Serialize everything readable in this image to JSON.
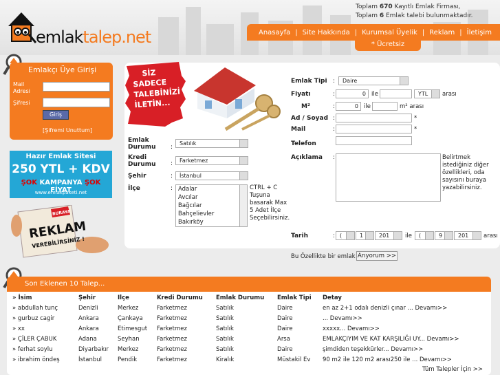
{
  "header": {
    "stats_line1_pre": "Toplam ",
    "stats_line1_num": "670",
    "stats_line1_post": " Kayıtlı Emlak Firması,",
    "stats_line2_pre": "Toplam ",
    "stats_line2_num": "6",
    "stats_line2_post": " Emlak talebi bulunmaktadır.",
    "logo_part1": "emlak",
    "logo_part2": "talep.net"
  },
  "nav": {
    "items": [
      "Anasayfa",
      "Site Hakkında",
      "Kurumsal Üyelik",
      "Reklam",
      "İletişim"
    ],
    "separator": "|",
    "sub": "* Ücretsiz"
  },
  "login": {
    "title": "Emlakçı Üye Girişi",
    "mail_label": "Mail Adresi",
    "password_label": "Şifresi",
    "submit": "Giriş",
    "forgot": "[Şifremi Unuttum]"
  },
  "banner1": {
    "line1": "Hazır Emlak Sitesi",
    "line2": "250 YTL + KDV",
    "line3_a": "ŞOK",
    "line3_b": " KAMPANYA ",
    "line3_c": "ŞOK",
    "line3_d": " FİYAT",
    "line4": "www.emlakpaketi.net"
  },
  "banner2": {
    "line1": "BURAYA",
    "line2": "REKLAM",
    "line3": "VEREBİLİRSİNİZ !"
  },
  "promo": {
    "line1": "SİZ",
    "line2": "SADECE",
    "line3": "TALEBİNİZİ",
    "line4": "İLETİN..."
  },
  "form": {
    "emlak_tipi_label": "Emlak Tipi",
    "emlak_tipi_value": "Daire",
    "fiyati_label": "Fiyatı",
    "fiyat_min": "0",
    "ile": "ile",
    "currency": "YTL",
    "arasi": "arası",
    "m2_label": "M²",
    "m2_min": "0",
    "m2_arasi": "m² arası",
    "adsoyad_label": "Ad / Soyad",
    "mail_label": "Mail",
    "star": "*",
    "telefon_label": "Telefon",
    "aciklama_label": "Açıklama",
    "aciklama_info": "Belirtmek istediğiniz diğer özellikleri, oda sayısını buraya yazabilirsiniz.",
    "emlak_durumu_label": "Emlak Durumu",
    "emlak_durumu_value": "Satılık",
    "kredi_durumu_label": "Kredi Durumu",
    "kredi_durumu_value": "Farketmez",
    "sehir_label": "Şehir",
    "sehir_value": "İstanbul",
    "ilce_label": "İlçe",
    "ilce_options": [
      "Adalar",
      "Avcılar",
      "Bağcılar",
      "Bahçelievler",
      "Bakırköy"
    ],
    "ilce_info": "CTRL + C Tuşuna basarak Max 5 Adet İlçe Seçebilirsiniz.",
    "colon": ":",
    "tarih_label": "Tarih",
    "tarih_d1": "(",
    "tarih_m1": "1",
    "tarih_y1": "201",
    "tarih_d2": "(",
    "tarih_m2": "9",
    "tarih_y2": "201",
    "bu_ozellik": "Bu Özellikte bir emlak",
    "anyorum": "Arıyorum >>"
  },
  "recent": {
    "title": "Son Eklenen 10 Talep...",
    "columns": [
      "İsim",
      "Şehir",
      "Ilçe",
      "Kredi Durumu",
      "Emlak Durumu",
      "Emlak Tipi",
      "Detay"
    ],
    "rows": [
      [
        "abdullah tunç",
        "Denizli",
        "Merkez",
        "Farketmez",
        "Satılık",
        "Daire",
        "en az 2+1 odalı denizli çınar ... Devamı>>"
      ],
      [
        "gurbuz cagir",
        "Ankara",
        "Çankaya",
        "Farketmez",
        "Satılık",
        "Daire",
        "... Devamı>>"
      ],
      [
        "xx",
        "Ankara",
        "Etimesgut",
        "Farketmez",
        "Satılık",
        "Daire",
        "xxxxx... Devamı>>"
      ],
      [
        "ÇİLER ÇABUK",
        "Adana",
        "Seyhan",
        "Farketmez",
        "Satılık",
        "Arsa",
        "EMLAKÇIYIM VE KAT KARŞILIĞI UY... Devamı>>"
      ],
      [
        "ferhat soylu",
        "Diyarbakır",
        "Merkez",
        "Farketmez",
        "Satılık",
        "Daire",
        "şimdiden teşekkürler... Devamı>>"
      ],
      [
        "ibrahim öndeş",
        "İstanbul",
        "Pendik",
        "Farketmez",
        "Kiralık",
        "Müstakil Ev",
        "90 m2 ile 120 m2 arası250 ile ... Devamı>>"
      ]
    ],
    "row_marker": "»",
    "all_link": "Tüm Talepler İçin >>"
  },
  "colors": {
    "accent": "#f47b20",
    "promo_red": "#d81f26",
    "banner_blue": "#24a7d6"
  }
}
